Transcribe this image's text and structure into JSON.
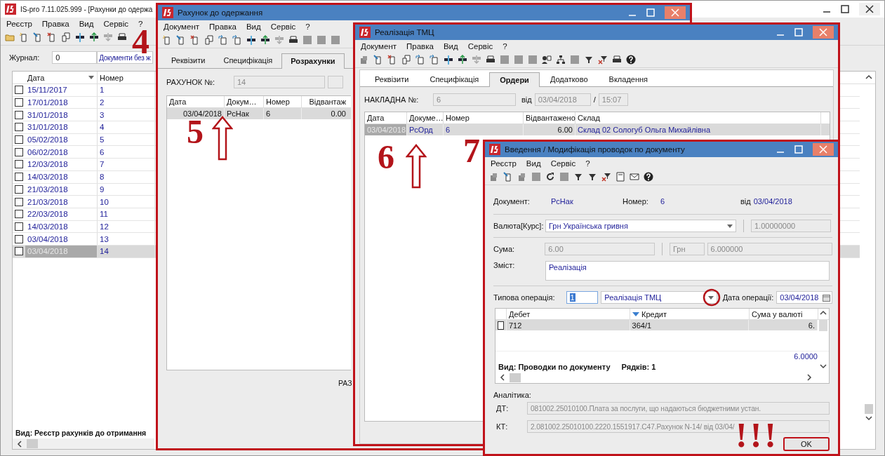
{
  "main_window": {
    "title": "IS-pro 7.11.025.999 - [Рахунки до одержа",
    "menu": [
      "Реєстр",
      "Правка",
      "Вид",
      "Сервіс",
      "?"
    ],
    "journal_label": "Журнал:",
    "journal_value": "0",
    "journal_name": "Документи без ж",
    "table": {
      "columns": [
        "Дата",
        "Номер"
      ],
      "rows": [
        {
          "date": "15/11/2017",
          "number": "1",
          "checked": false,
          "selected": false
        },
        {
          "date": "17/01/2018",
          "number": "2",
          "checked": false,
          "selected": false
        },
        {
          "date": "31/01/2018",
          "number": "3",
          "checked": false,
          "selected": false
        },
        {
          "date": "31/01/2018",
          "number": "4",
          "checked": false,
          "selected": false
        },
        {
          "date": "05/02/2018",
          "number": "5",
          "checked": false,
          "selected": false
        },
        {
          "date": "06/02/2018",
          "number": "6",
          "checked": false,
          "selected": false
        },
        {
          "date": "12/03/2018",
          "number": "7",
          "checked": false,
          "selected": false
        },
        {
          "date": "14/03/2018",
          "number": "8",
          "checked": false,
          "selected": false
        },
        {
          "date": "21/03/2018",
          "number": "9",
          "checked": false,
          "selected": false
        },
        {
          "date": "21/03/2018",
          "number": "10",
          "checked": false,
          "selected": false
        },
        {
          "date": "22/03/2018",
          "number": "11",
          "checked": false,
          "selected": false
        },
        {
          "date": "14/03/2018",
          "number": "12",
          "checked": false,
          "selected": false
        },
        {
          "date": "03/04/2018",
          "number": "13",
          "checked": false,
          "selected": false
        },
        {
          "date": "03/04/2018",
          "number": "14",
          "checked": false,
          "selected": true
        }
      ]
    },
    "status": "Вид: Реєстр рахунків до отримання"
  },
  "invoice_window": {
    "title": "Рахунок до одержання",
    "menu": [
      "Документ",
      "Правка",
      "Вид",
      "Сервіс",
      "?"
    ],
    "tabs": [
      {
        "label": "Реквізити",
        "selected": false
      },
      {
        "label": "Специфікація",
        "selected": false
      },
      {
        "label": "Розрахунки",
        "selected": true
      }
    ],
    "number_label": "РАХУНОК №:",
    "number_value": "14",
    "table": {
      "columns": [
        "Дата",
        "Докум…",
        "Номер",
        "Відвантаж"
      ],
      "rows": [
        {
          "cells": [
            "03/04/2018",
            "РсНак",
            "6",
            "0.00"
          ],
          "selected": true
        }
      ]
    },
    "footer_text": "РАЗ"
  },
  "sale_window": {
    "title": "Реалізація ТМЦ",
    "menu": [
      "Документ",
      "Правка",
      "Вид",
      "Сервіс",
      "?"
    ],
    "tabs": [
      {
        "label": "Реквізити",
        "selected": false
      },
      {
        "label": "Специфікація",
        "selected": false
      },
      {
        "label": "Ордери",
        "selected": true
      },
      {
        "label": "Додатково",
        "selected": false
      },
      {
        "label": "Вкладення",
        "selected": false
      }
    ],
    "number_label": "НАКЛАДНА №:",
    "number_value": "6",
    "date_label": "від",
    "date_value": "03/04/2018",
    "separator": "/",
    "time_value": "15:07",
    "table": {
      "columns": [
        "Дата",
        "Докуме…",
        "Номер",
        "Відвантажено",
        "Склад"
      ],
      "rows": [
        {
          "cells": [
            "03/04/2018",
            "РсОрд",
            "6",
            "6.00",
            "Склад 02 Сологуб Ольга Михайлівна"
          ],
          "selected": true
        }
      ]
    }
  },
  "entries_window": {
    "title": "Введення / Модифікація проводок по документу",
    "menu": [
      "Реєстр",
      "Вид",
      "Сервіс",
      "?"
    ],
    "document_label": "Документ:",
    "document_value": "РсНак",
    "number_label": "Номер:",
    "number_value": "6",
    "date_label": "від",
    "date_value": "03/04/2018",
    "currency_label": "Валюта[Курс]:",
    "currency_value": "Грн Українська гривня",
    "rate_value": "1.00000000",
    "sum_label": "Сума:",
    "sum_value": "6.00",
    "sum_currency": "Грн",
    "sum_currency_value": "6.000000",
    "content_label": "Зміст:",
    "content_value": "Реалізація",
    "operation_label": "Типова операція:",
    "operation_code": "1",
    "operation_value": "Реалізація ТМЦ",
    "operation_date_label": "Дата операції:",
    "operation_date_value": "03/04/2018",
    "table": {
      "columns": [
        "Дебет",
        "Кредит",
        "Сума у валюті"
      ],
      "rows": [
        {
          "debit": "712",
          "credit": "364/1",
          "amount": "6.",
          "checked": false,
          "selected": true
        }
      ],
      "total": "6.0000",
      "view_label": "Вид: Проводки по документу",
      "rows_label": "Рядків: 1"
    },
    "analytics_label": "Аналітика:",
    "dt_label": "ДТ:",
    "dt_value": "081002.25010100.Плата за послуги, що надаються бюджетними устан.",
    "kt_label": "КТ:",
    "kt_value": "2.081002.25010100.2220.1551917.С47.Рахунок N-14/ від 03/04/",
    "ok_button": "OK"
  },
  "annotations": [
    {
      "kind": "number",
      "text": "4"
    },
    {
      "kind": "number",
      "text": "5"
    },
    {
      "kind": "number",
      "text": "6"
    },
    {
      "kind": "number",
      "text": "7"
    },
    {
      "kind": "exclamation",
      "text": "!!!"
    }
  ]
}
